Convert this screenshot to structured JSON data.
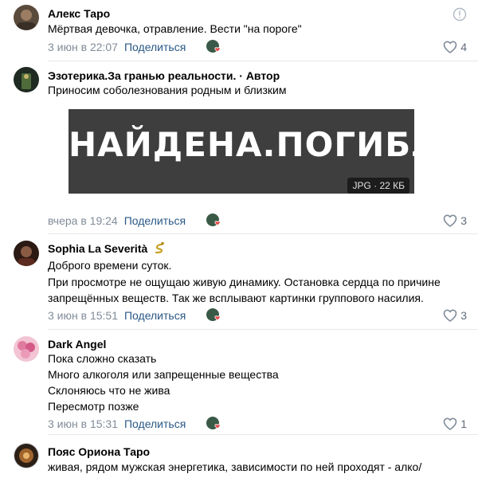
{
  "comments": [
    {
      "author": "Алекс Таро",
      "text_lines": [
        "Мёртвая девочка, отравление. Вести \"на пороге\""
      ],
      "date": "3 июн в 22:07",
      "share_label": "Поделиться",
      "likes": "4"
    },
    {
      "author": "Эзотерика.За гранью реальности.",
      "author_role": " · Автор",
      "text_lines": [
        "Приносим соболезнования родным и близким"
      ],
      "image": {
        "headline": "НАЙДЕНА.ПОГИБЛА",
        "badge": "JPG · 22 КБ"
      },
      "date": "вчера в 19:24",
      "share_label": "Поделиться",
      "likes": "3"
    },
    {
      "author": "Sophia La Severità",
      "text_lines": [
        "Доброго времени суток.",
        "При просмотре не ощущаю живую динамику. Остановка сердца по причине",
        "запрещённых веществ. Так же всплывают картинки группового насилия."
      ],
      "date": "3 июн в 15:51",
      "share_label": "Поделиться",
      "likes": "3"
    },
    {
      "author": "Dark Angel",
      "text_lines": [
        "Пока сложно сказать",
        "Много алкоголя или запрещенные вещества",
        "Склоняюсь что не жива",
        "Пересмотр позже"
      ],
      "date": "3 июн в 15:31",
      "share_label": "Поделиться",
      "likes": "1"
    },
    {
      "author": "Пояс Ориона Таро",
      "text_lines": [
        "живая, рядом мужская энергетика, зависимости по ней проходят - алко/"
      ]
    }
  ],
  "icons": {
    "report": "report-icon",
    "like": "heart-outline-icon",
    "reactions": "reactions-avatar-heart-icon",
    "snake": "snake-emoji-icon"
  },
  "colors": {
    "link": "#2a5885",
    "meta": "#818c99",
    "separator": "#e7e8ec",
    "heart_reaction": "#e64646"
  }
}
